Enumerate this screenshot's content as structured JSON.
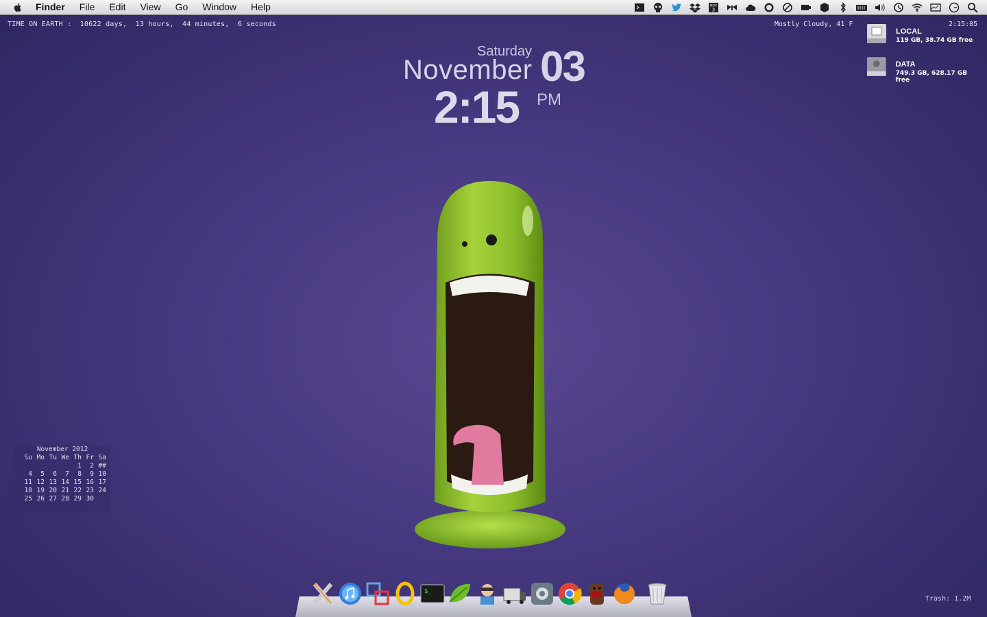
{
  "menubar": {
    "app_name": "Finder",
    "items": [
      "File",
      "Edit",
      "View",
      "Go",
      "Window",
      "Help"
    ],
    "status_icons": [
      "terminal-icon",
      "skull-icon",
      "twitter-icon",
      "dropbox-icon",
      "calendar-icon",
      "butterfly-icon",
      "cloud-icon",
      "whatsapp-icon",
      "no-entry-icon",
      "battery-icon",
      "box-icon",
      "bluetooth-icon",
      "memory-icon",
      "volume-icon",
      "time-machine-icon",
      "wifi-icon",
      "activity-icon",
      "clock-icon",
      "spotlight-icon"
    ],
    "calendar_icon_text": {
      "month": "NOV",
      "day": "3"
    }
  },
  "geektool": {
    "time_on_earth": "TIME ON EARTH :  10622 days,  13 hours,  44 minutes,  6 seconds",
    "weather": "Mostly Cloudy, 41 F",
    "clock": "2:15:05",
    "trash": "Trash: 1.2M"
  },
  "drives": [
    {
      "name": "LOCAL",
      "info": "119 GB, 38.74 GB free"
    },
    {
      "name": "DATA",
      "info": "749.3 GB, 628.17 GB free"
    }
  ],
  "date_widget": {
    "weekday": "Saturday",
    "month": "November",
    "day": "03",
    "time": "2:15",
    "ampm": "PM"
  },
  "calendar": {
    "title": "November 2012",
    "header": [
      "Su",
      "Mo",
      "Tu",
      "We",
      "Th",
      "Fr",
      "Sa"
    ],
    "weeks": [
      [
        "",
        "",
        "",
        "",
        "1",
        "2",
        "##"
      ],
      [
        "4",
        "5",
        "6",
        "7",
        "8",
        "9",
        "10"
      ],
      [
        "11",
        "12",
        "13",
        "14",
        "15",
        "16",
        "17"
      ],
      [
        "18",
        "19",
        "20",
        "21",
        "22",
        "23",
        "24"
      ],
      [
        "25",
        "26",
        "27",
        "28",
        "29",
        "30",
        ""
      ]
    ]
  },
  "dock": {
    "apps": [
      "x-icon",
      "itunes-icon",
      "vmware-icon",
      "opera-icon",
      "terminal-icon",
      "leaf-icon",
      "ninja-icon",
      "transmit-icon",
      "system-preferences-icon",
      "chrome-icon",
      "domo-icon",
      "firefox-icon",
      "trash-icon"
    ]
  }
}
